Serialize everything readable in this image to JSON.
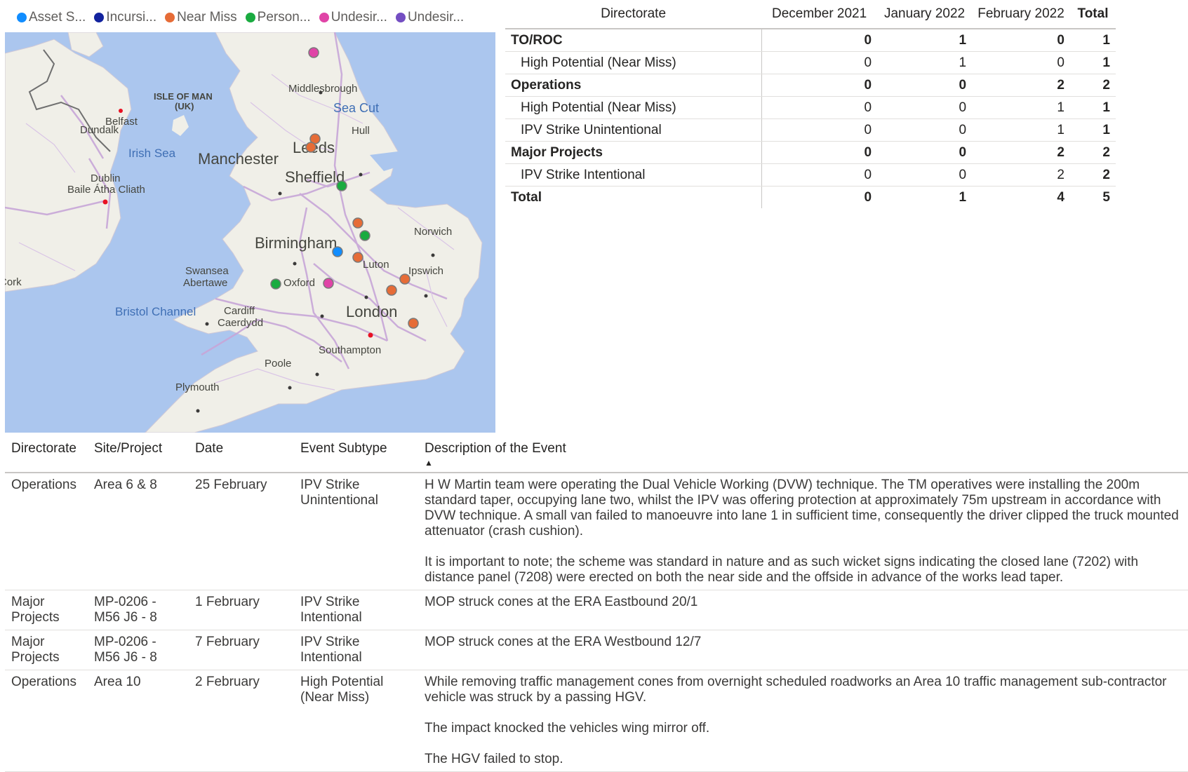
{
  "legend": {
    "items": [
      {
        "label": "Asset S...",
        "color": "#118dff"
      },
      {
        "label": "Incursi...",
        "color": "#12239e"
      },
      {
        "label": "Near Miss",
        "color": "#e66c37"
      },
      {
        "label": "Person...",
        "color": "#1aab40"
      },
      {
        "label": "Undesir...",
        "color": "#e044a7"
      },
      {
        "label": "Undesir...",
        "color": "#744ec2"
      }
    ]
  },
  "map": {
    "labels": {
      "belfast": "Belfast",
      "isle_of_man": "ISLE OF MAN",
      "uk": "(UK)",
      "middlesbrough": "Middlesbrough",
      "sea_cut": "Sea Cut",
      "dundalk": "Dundalk",
      "hull": "Hull",
      "irish_sea": "Irish Sea",
      "manchester": "Manchester",
      "leeds": "Leeds",
      "sheffield": "Sheffield",
      "dublin": "Dublin",
      "baile": "Baile Átha Cliath",
      "norwich": "Norwich",
      "birmingham": "Birmingham",
      "luton": "Luton",
      "swansea": "Swansea",
      "abertawe": "Abertawe",
      "oxford": "Oxford",
      "ipswich": "Ipswich",
      "cork": "Cork",
      "bristol_channel": "Bristol Channel",
      "cardiff": "Cardiff",
      "caerdydd": "Caerdydd",
      "london": "London",
      "southampton": "Southampton",
      "poole": "Poole",
      "plymouth": "Plymouth"
    },
    "markers": [
      {
        "category": "Undesirable",
        "color": "#e044a7"
      },
      {
        "category": "Near Miss",
        "color": "#e66c37"
      },
      {
        "category": "Near Miss",
        "color": "#e66c37"
      },
      {
        "category": "Personal",
        "color": "#1aab40"
      },
      {
        "category": "Near Miss",
        "color": "#e66c37"
      },
      {
        "category": "Personal",
        "color": "#1aab40"
      },
      {
        "category": "Asset Strike",
        "color": "#118dff"
      },
      {
        "category": "Near Miss",
        "color": "#e66c37"
      },
      {
        "category": "Personal",
        "color": "#1aab40"
      },
      {
        "category": "Undesirable",
        "color": "#e044a7"
      },
      {
        "category": "Near Miss",
        "color": "#e66c37"
      },
      {
        "category": "Near Miss",
        "color": "#e66c37"
      },
      {
        "category": "Near Miss",
        "color": "#e66c37"
      }
    ]
  },
  "matrix": {
    "headers": [
      "Directorate",
      "December 2021",
      "January 2022",
      "February 2022",
      "Total"
    ],
    "rows": [
      {
        "label": "TO/ROC",
        "values": [
          "0",
          "1",
          "0",
          "1"
        ]
      },
      {
        "label": "High Potential (Near Miss)",
        "values": [
          "0",
          "1",
          "0",
          "1"
        ]
      },
      {
        "label": "Operations",
        "values": [
          "0",
          "0",
          "2",
          "2"
        ]
      },
      {
        "label": "High Potential (Near Miss)",
        "values": [
          "0",
          "0",
          "1",
          "1"
        ]
      },
      {
        "label": "IPV Strike Unintentional",
        "values": [
          "0",
          "0",
          "1",
          "1"
        ]
      },
      {
        "label": "Major Projects",
        "values": [
          "0",
          "0",
          "2",
          "2"
        ]
      },
      {
        "label": "IPV Strike Intentional",
        "values": [
          "0",
          "0",
          "2",
          "2"
        ]
      },
      {
        "label": "Total",
        "values": [
          "0",
          "1",
          "4",
          "5"
        ]
      }
    ]
  },
  "detail": {
    "headers": [
      "Directorate",
      "Site/Project",
      "Date",
      "Event Subtype",
      "Description of the Event"
    ],
    "rows": [
      {
        "directorate": "Operations",
        "site": "Area 6 & 8",
        "date": "25 February",
        "subtype": "IPV Strike Unintentional",
        "desc": [
          "H W Martin team were operating the Dual Vehicle Working (DVW) technique. The TM operatives were installing the 200m standard taper, occupying lane two, whilst the IPV was offering protection at approximately 75m upstream in accordance with DVW technique. A small van failed to manoeuvre into lane 1 in sufficient time, consequently the driver clipped the truck mounted attenuator (crash cushion).",
          "It is important to note; the scheme was standard in nature and as such wicket signs indicating the closed lane (7202) with distance panel (7208) were erected on both the near side and the offside in advance of the works lead taper."
        ]
      },
      {
        "directorate": "Major Projects",
        "site": "MP-0206 - M56 J6 - 8",
        "date": "1 February",
        "subtype": "IPV Strike Intentional",
        "desc": [
          "MOP struck cones at the ERA Eastbound 20/1"
        ]
      },
      {
        "directorate": "Major Projects",
        "site": "MP-0206 - M56 J6 - 8",
        "date": "7 February",
        "subtype": "IPV Strike Intentional",
        "desc": [
          "MOP struck cones at the ERA Westbound 12/7"
        ]
      },
      {
        "directorate": "Operations",
        "site": "Area 10",
        "date": "2 February",
        "subtype": "High Potential (Near Miss)",
        "desc": [
          "While removing traffic management cones from overnight scheduled roadworks an Area 10 traffic management sub-contractor vehicle was struck by a passing HGV.",
          "The impact knocked the vehicles wing mirror off.",
          "The HGV failed to stop."
        ]
      }
    ]
  }
}
